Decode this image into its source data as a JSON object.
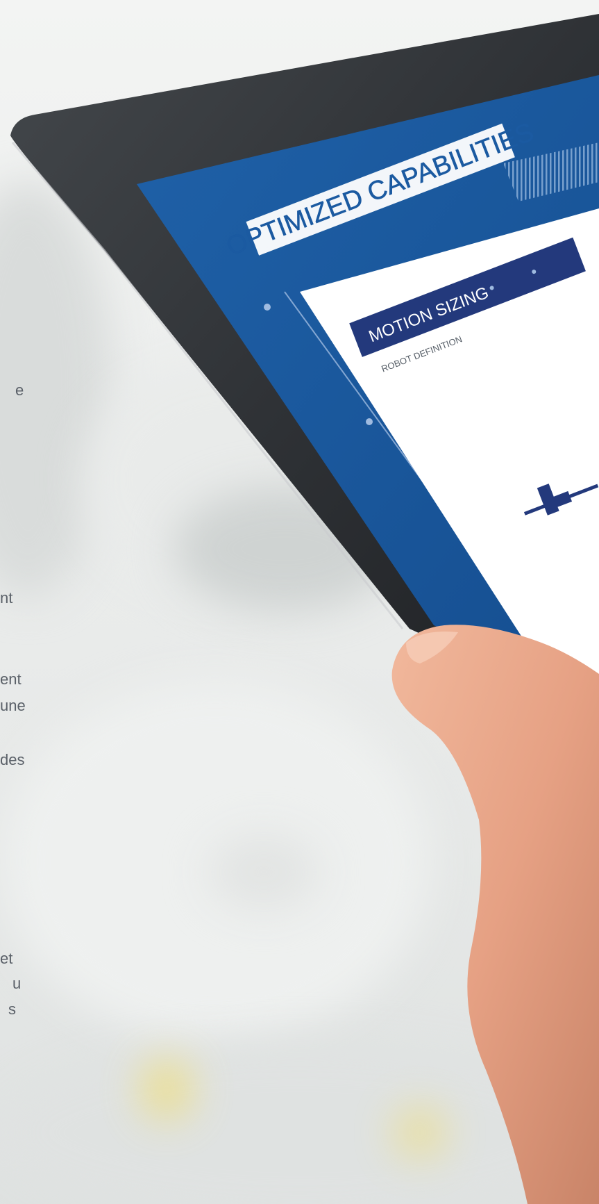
{
  "background": {
    "description_colors": [
      "#f3f4f3",
      "#e8eae9",
      "#d8dcda"
    ],
    "accent_light": "#f3dd62"
  },
  "left_text_fragments": [
    "e",
    "nt",
    "ent",
    "une",
    "des",
    "et",
    "u",
    "s"
  ],
  "tablet": {
    "bezel_color": "#2f3236",
    "screen_blue": "#1b5aa1",
    "header_title": "OPTIMIZED CAPABILITIES",
    "panel_header": "MOTION SIZING",
    "panel_subtitle": "ROBOT DEFINITION",
    "panel_header_color": "#23397c"
  },
  "hand": {
    "skin_color": "#e6a184"
  }
}
